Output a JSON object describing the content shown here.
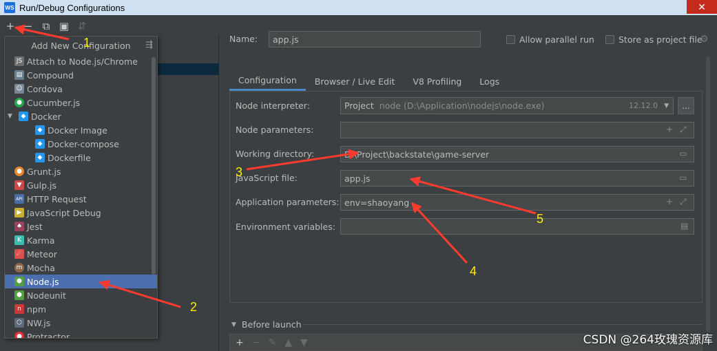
{
  "window": {
    "title": "Run/Debug Configurations",
    "close_glyph": "✕",
    "app_icon_text": "WS"
  },
  "toolbar": {
    "add_glyph": "+",
    "remove_glyph": "−",
    "copy_glyph": "⧉",
    "folder_glyph": "▣",
    "sort_glyph": "⇵"
  },
  "popup": {
    "title": "Add New Configuration",
    "items": [
      {
        "label": "Attach to Node.js/Chrome",
        "icon": "nodejs-attach-icon",
        "color": "#8c8c8c",
        "glyph": "JS"
      },
      {
        "label": "Compound",
        "icon": "folder-icon",
        "color": "#6b7f8e",
        "glyph": "▤"
      },
      {
        "label": "Cordova",
        "icon": "cordova-icon",
        "color": "#7a8896",
        "glyph": "☺"
      },
      {
        "label": "Cucumber.js",
        "icon": "cucumber-icon",
        "color": "#23a94c",
        "glyph": "●"
      },
      {
        "label": "Docker",
        "icon": "docker-icon",
        "color": "#2496ed",
        "glyph": "◆"
      },
      {
        "label": "Docker Image",
        "icon": "docker-icon",
        "color": "#2496ed",
        "glyph": "◆"
      },
      {
        "label": "Docker-compose",
        "icon": "docker-icon",
        "color": "#2496ed",
        "glyph": "◆"
      },
      {
        "label": "Dockerfile",
        "icon": "docker-icon",
        "color": "#2496ed",
        "glyph": "◆"
      },
      {
        "label": "Grunt.js",
        "icon": "grunt-icon",
        "color": "#e48632",
        "glyph": "●"
      },
      {
        "label": "Gulp.js",
        "icon": "gulp-icon",
        "color": "#cf4646",
        "glyph": "▼"
      },
      {
        "label": "HTTP Request",
        "icon": "api-icon",
        "color": "#4a6fa5",
        "glyph": "API"
      },
      {
        "label": "JavaScript Debug",
        "icon": "js-debug-icon",
        "color": "#c9b230",
        "glyph": "▶"
      },
      {
        "label": "Jest",
        "icon": "jest-icon",
        "color": "#99425b",
        "glyph": "♠"
      },
      {
        "label": "Karma",
        "icon": "karma-icon",
        "color": "#3cbeae",
        "glyph": "K"
      },
      {
        "label": "Meteor",
        "icon": "meteor-icon",
        "color": "#de4f4f",
        "glyph": "☄"
      },
      {
        "label": "Mocha",
        "icon": "mocha-icon",
        "color": "#8d6748",
        "glyph": "m"
      },
      {
        "label": "Node.js",
        "icon": "nodejs-icon",
        "color": "#539e43",
        "glyph": "⬢"
      },
      {
        "label": "Nodeunit",
        "icon": "nodeunit-icon",
        "color": "#539e43",
        "glyph": "⬢"
      },
      {
        "label": "npm",
        "icon": "npm-icon",
        "color": "#cb3837",
        "glyph": "n"
      },
      {
        "label": "NW.js",
        "icon": "nwjs-icon",
        "color": "#5c6b7a",
        "glyph": "⬡"
      },
      {
        "label": "Protractor",
        "icon": "protractor-icon",
        "color": "#e23237",
        "glyph": "●"
      }
    ]
  },
  "form": {
    "name_label": "Name:",
    "name_value": "app.js",
    "allow_parallel": "Allow parallel run",
    "store_project": "Store as project file",
    "tabs": [
      "Configuration",
      "Browser / Live Edit",
      "V8 Profiling",
      "Logs"
    ],
    "node_interpreter_label": "Node interpreter:",
    "interpreter_kind": "Project",
    "interpreter_path": "node (D:\\Application\\nodejs\\node.exe)",
    "interpreter_version": "12.12.0",
    "dots": "...",
    "node_params_label": "Node parameters:",
    "node_params_value": "",
    "working_dir_label": "Working directory:",
    "working_dir_value": "D:\\Project\\backstate\\game-server",
    "js_file_label": "JavaScript file:",
    "js_file_value": "app.js",
    "app_params_label": "Application parameters:",
    "app_params_value": "env=shaoyang",
    "env_vars_label": "Environment variables:",
    "env_vars_value": "",
    "before_launch": "Before launch"
  },
  "annotations": [
    "1",
    "2",
    "3",
    "4",
    "5"
  ],
  "watermark": "CSDN @264玫瑰资源库",
  "colors": {
    "selection": "#4b6eaf",
    "arrow": "#ff3b30",
    "number": "#ffee00"
  }
}
